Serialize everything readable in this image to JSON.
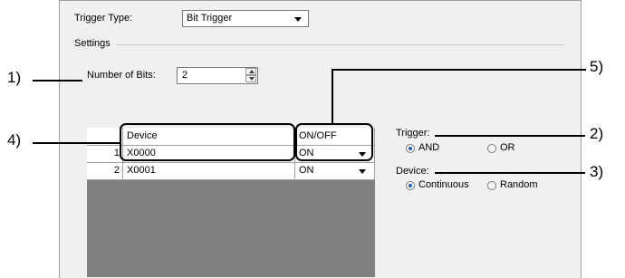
{
  "trigger_type": {
    "label": "Trigger Type:",
    "value": "Bit Trigger"
  },
  "settings": {
    "group_label": "Settings"
  },
  "number_of_bits": {
    "label": "Number of Bits:",
    "value": "2"
  },
  "table": {
    "headers": [
      "Device",
      "ON/OFF"
    ],
    "rows": [
      {
        "index": "1",
        "device": "X0000",
        "state": "ON"
      },
      {
        "index": "2",
        "device": "X0001",
        "state": "ON"
      }
    ]
  },
  "trigger": {
    "label": "Trigger:",
    "options": [
      "AND",
      "OR"
    ],
    "selected": "AND"
  },
  "device": {
    "label": "Device:",
    "options": [
      "Continuous",
      "Random"
    ],
    "selected": "Continuous"
  },
  "callouts": [
    "1)",
    "2)",
    "3)",
    "4)",
    "5)"
  ]
}
